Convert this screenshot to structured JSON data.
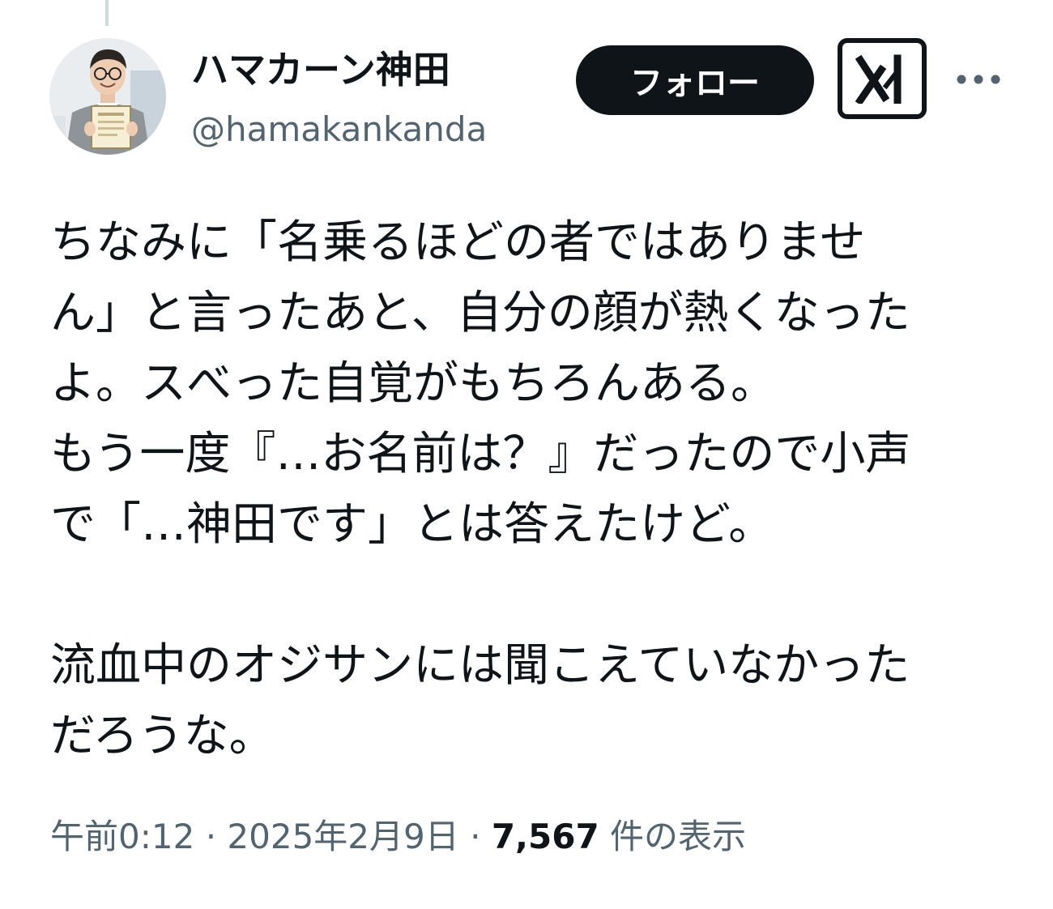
{
  "header": {
    "display_name": "ハマカーン神田",
    "handle": "@hamakankanda",
    "follow_label": "フォロー",
    "grok_icon": "grok-icon",
    "more_icon": "more-icon"
  },
  "tweet": {
    "lines": [
      "ちなみに「名乗るほどの者ではありませ",
      "ん」と言ったあと、自分の顔が熱くなった",
      "よ。スべった自覚がもちろんある。",
      "もう一度『…お名前は？』だったので小声",
      "で「…神田です」とは答えたけど。",
      "",
      "流血中のオジサンには聞こえていなかった",
      "だろうな。"
    ]
  },
  "meta": {
    "time": "午前0:12",
    "separator": "·",
    "date": "2025年2月9日",
    "views_count": "7,567",
    "views_label": "件の表示"
  },
  "colors": {
    "text": "#0f1419",
    "secondary": "#536471",
    "follow_bg": "#0f1419",
    "follow_text": "#ffffff"
  }
}
